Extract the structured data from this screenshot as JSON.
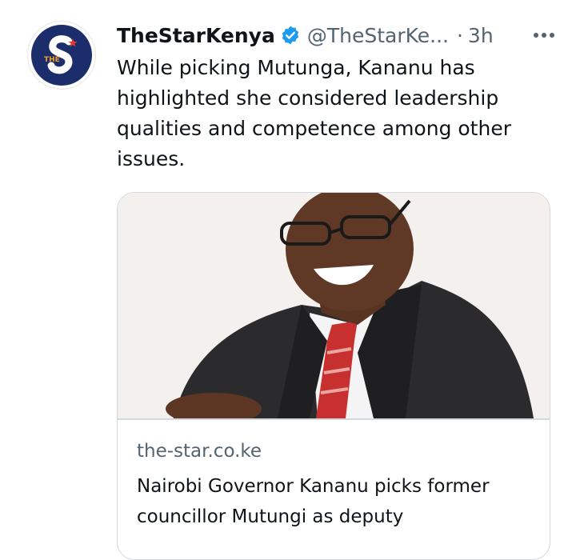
{
  "tweet": {
    "author_name": "TheStarKenya",
    "handle": "@TheStarKe...",
    "separator": "·",
    "time": "3h",
    "text": "While picking Mutunga, Kananu has highlighted she considered leadership qualities and competence among other issues."
  },
  "link_card": {
    "domain": "the-star.co.ke",
    "title": "Nairobi Governor Kananu picks former councillor Mutungi as deputy"
  },
  "colors": {
    "brand_navy": "#1b2d6b",
    "verified_blue": "#1d9bf0",
    "secondary_text": "#536471",
    "border": "#cfd9de"
  },
  "icons": {
    "verified": "verified-badge-icon",
    "more": "more-options-icon",
    "avatar": "the-star-logo"
  }
}
